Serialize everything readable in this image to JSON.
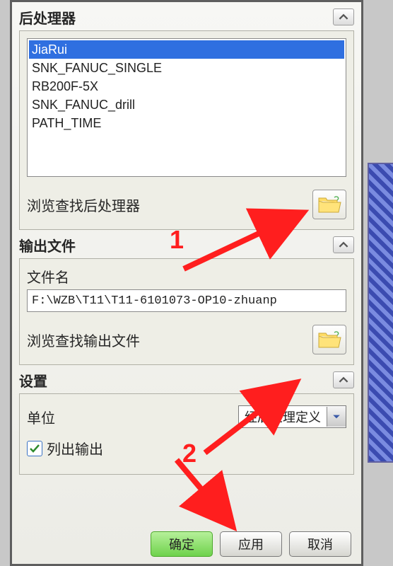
{
  "sections": {
    "post": {
      "title": "后处理器",
      "items": [
        "JiaRui",
        "SNK_FANUC_SINGLE",
        "RB200F-5X",
        "SNK_FANUC_drill",
        "PATH_TIME"
      ],
      "selected_index": 0,
      "browse_label": "浏览查找后处理器"
    },
    "output": {
      "title": "输出文件",
      "file_label": "文件名",
      "file_value": "F:\\WZB\\T11\\T11-6101073-OP10-zhuanp",
      "browse_label": "浏览查找输出文件"
    },
    "settings": {
      "title": "设置",
      "unit_label": "单位",
      "unit_value": "经后处理定义",
      "list_output_label": "列出输出",
      "list_output_checked": true
    }
  },
  "buttons": {
    "ok": "确定",
    "apply": "应用",
    "cancel": "取消"
  },
  "annotations": {
    "one": "1",
    "two": "2"
  }
}
